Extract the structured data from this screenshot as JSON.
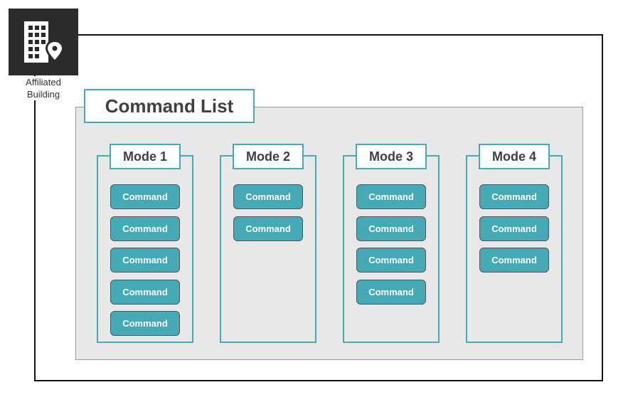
{
  "building": {
    "icon": "building-location-icon",
    "caption_line1": "Affiliated",
    "caption_line2": "Building"
  },
  "command_list": {
    "title": "Command List"
  },
  "modes": [
    {
      "label": "Mode 1",
      "commands": [
        "Command",
        "Command",
        "Command",
        "Command",
        "Command"
      ]
    },
    {
      "label": "Mode 2",
      "commands": [
        "Command",
        "Command"
      ]
    },
    {
      "label": "Mode 3",
      "commands": [
        "Command",
        "Command",
        "Command",
        "Command"
      ]
    },
    {
      "label": "Mode 4",
      "commands": [
        "Command",
        "Command",
        "Command"
      ]
    }
  ],
  "colors": {
    "accent": "#45aab5",
    "panel": "#e8e8e8",
    "icon_bg": "#2b2b2b",
    "text": "#404040"
  }
}
